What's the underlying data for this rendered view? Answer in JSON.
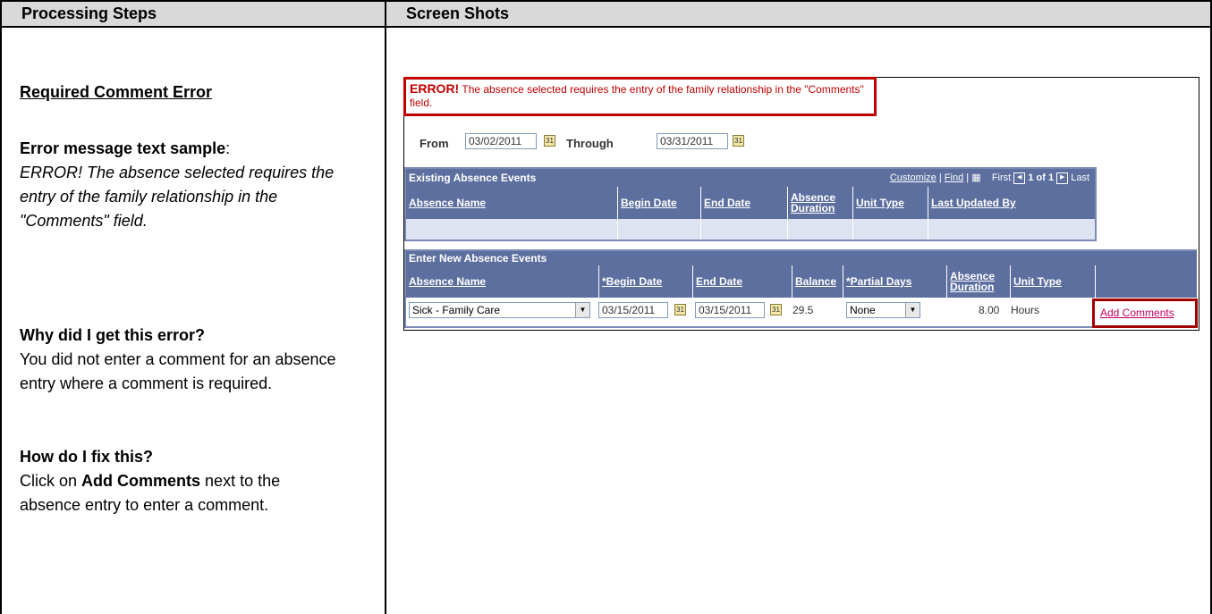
{
  "header": {
    "left": "Processing Steps",
    "right": "Screen Shots"
  },
  "left": {
    "title": "Required Comment Error",
    "sample_label": "Error message text sample",
    "sample_colon": ":",
    "sample_text": "ERROR! The absence selected requires the entry of the family relationship in the \"Comments\" field.",
    "why_heading": "Why did I get this error?",
    "why_text": "You did not enter a comment for an absence entry where a comment is required.",
    "fix_heading": "How do I fix this?",
    "fix_prefix": "Click on ",
    "fix_bold": "Add Comments",
    "fix_suffix": " next to the absence entry to enter a comment."
  },
  "shot": {
    "error_label": "ERROR!",
    "error_text": "The absence selected requires the entry of the family relationship in the \"Comments\" field.",
    "from_label": "From",
    "from_value": "03/02/2011",
    "through_label": "Through",
    "through_value": "03/31/2011",
    "existing": {
      "title": "Existing Absence Events",
      "customize": "Customize",
      "find": "Find",
      "first": "First",
      "range": "1 of 1",
      "last": "Last",
      "columns": [
        "Absence Name",
        "Begin Date",
        "End Date",
        "Absence Duration",
        "Unit Type",
        "Last Updated By"
      ]
    },
    "enter": {
      "title": "Enter New Absence Events",
      "columns": [
        "Absence Name",
        "*Begin Date",
        "End Date",
        "Balance",
        "*Partial Days",
        "Absence Duration",
        "Unit Type"
      ],
      "row": {
        "absence_name": "Sick - Family Care",
        "begin_date": "03/15/2011",
        "end_date": "03/15/2011",
        "balance": "29.5",
        "partial_days": "None",
        "duration": "8.00",
        "unit_type": "Hours",
        "add_comments": "Add Comments"
      }
    }
  }
}
